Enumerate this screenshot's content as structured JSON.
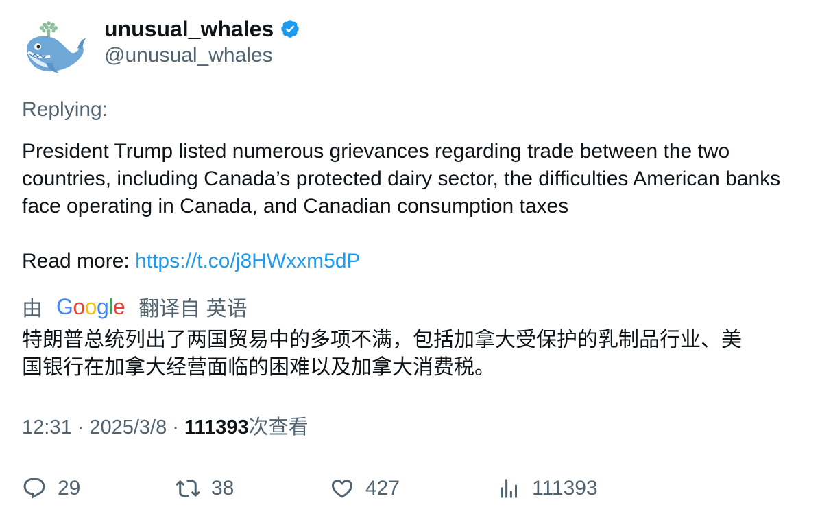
{
  "author": {
    "display_name": "unusual_whales",
    "handle": "@unusual_whales",
    "verified": true,
    "avatar_icon": "whale-avatar-icon"
  },
  "replying_label": "Replying:",
  "tweet": {
    "text": "President Trump listed numerous grievances regarding trade between the two countries, including Canada’s protected dairy sector, the difficulties American banks face operating in Canada, and Canadian consumption taxes",
    "read_more_label": "Read more: ",
    "link": "https://t.co/j8HWxxm5dP"
  },
  "translation": {
    "prefix": "由",
    "provider": "Google",
    "suffix": "翻译自 英语",
    "text_line1": "特朗普总统列出了两国贸易中的多项不满，包括加拿大受保护的乳制品行业、美",
    "text_line2": "国银行在加拿大经营面临的困难以及加拿大消费税。"
  },
  "meta": {
    "time": "12:31",
    "separator": " · ",
    "date": "2025/3/8",
    "views_count": "111393",
    "views_label": "次查看"
  },
  "actions": {
    "replies": "29",
    "retweets": "38",
    "likes": "427",
    "views": "111393"
  },
  "colors": {
    "secondary_text": "#536471",
    "link": "#1d9bf0",
    "verified_badge": "#1d9bf0"
  }
}
